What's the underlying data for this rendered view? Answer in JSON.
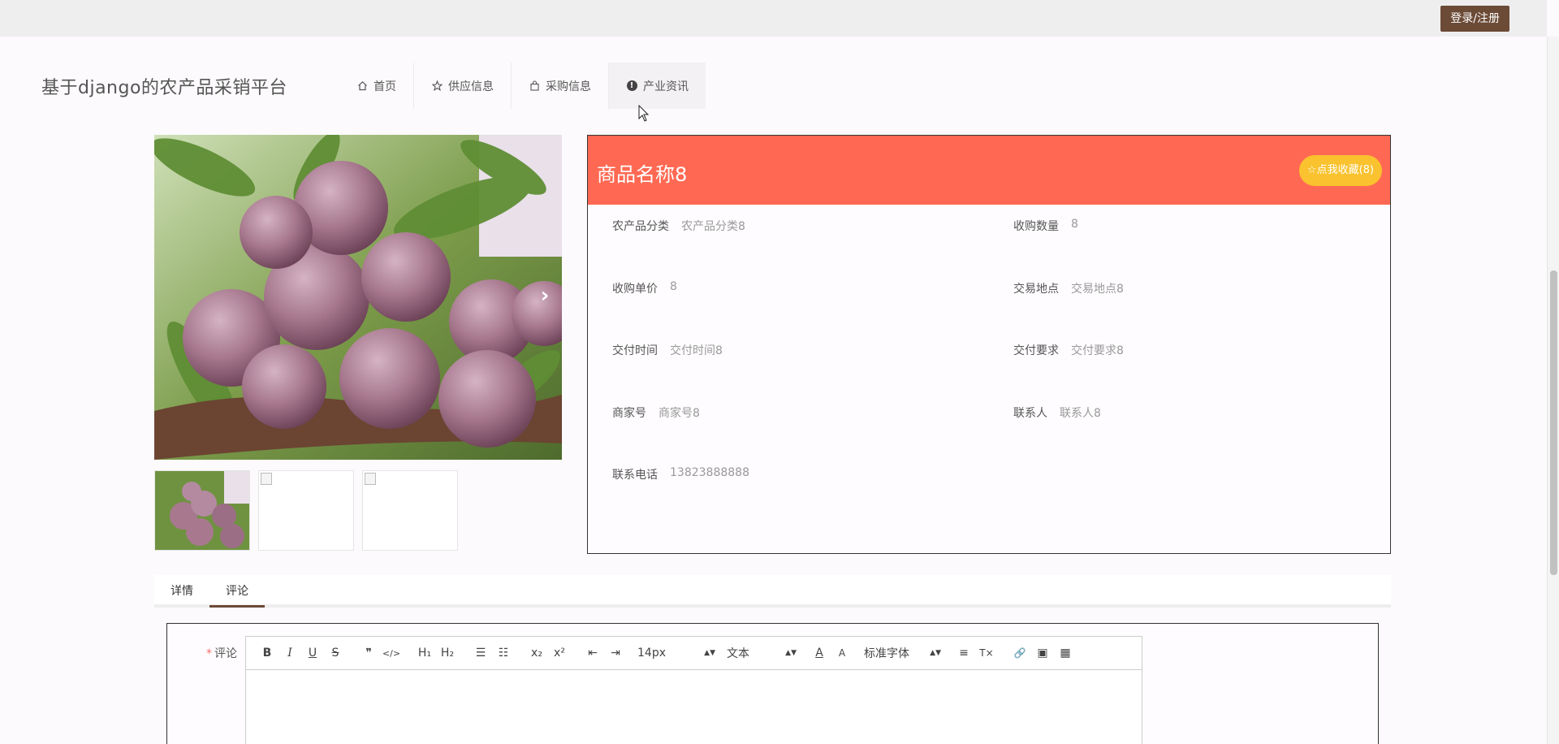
{
  "topbar": {
    "login_label": "登录/注册"
  },
  "header": {
    "site_title": "基于django的农产品采销平台",
    "nav": [
      {
        "label": "首页",
        "icon": "home-icon"
      },
      {
        "label": "供应信息",
        "icon": "star-icon"
      },
      {
        "label": "采购信息",
        "icon": "bag-icon"
      },
      {
        "label": "产业资讯",
        "icon": "info-icon",
        "icon_glyph": "!"
      }
    ]
  },
  "gallery": {
    "next_glyph": "›"
  },
  "product": {
    "name": "商品名称8",
    "favorite_label": "☆点我收藏(8)",
    "fields": [
      {
        "label": "农产品分类",
        "value": "农产品分类8"
      },
      {
        "label": "收购数量",
        "value": "8"
      },
      {
        "label": "收购单价",
        "value": "8"
      },
      {
        "label": "交易地点",
        "value": "交易地点8"
      },
      {
        "label": "交付时间",
        "value": "交付时间8"
      },
      {
        "label": "交付要求",
        "value": "交付要求8"
      },
      {
        "label": "商家号",
        "value": "商家号8"
      },
      {
        "label": "联系人",
        "value": "联系人8"
      },
      {
        "label": "联系电话",
        "value": "13823888888"
      }
    ]
  },
  "tabs": [
    {
      "label": "详情"
    },
    {
      "label": "评论",
      "active": true
    }
  ],
  "comment_form": {
    "required_mark": "*",
    "label": "评论",
    "toolbar": {
      "bold": "B",
      "italic": "I",
      "underline": "U",
      "strike": "S",
      "quote": "❞",
      "code": "</>",
      "h1": "H₁",
      "h2": "H₂",
      "ordered_list": "☰",
      "bullet_list": "☷",
      "subscript": "x₂",
      "superscript": "x²",
      "outdent": "⇤",
      "indent": "⇥",
      "size_value": "14px",
      "style_value": "文本",
      "font_value": "标准字体",
      "color": "A",
      "background": "A",
      "align": "≡",
      "clean": "T×",
      "link": "🔗",
      "image": "▣",
      "video": "▦"
    }
  },
  "colors": {
    "accent": "#6b4a36",
    "panel_header": "#ff6953",
    "favorite": "#f9c22e"
  }
}
